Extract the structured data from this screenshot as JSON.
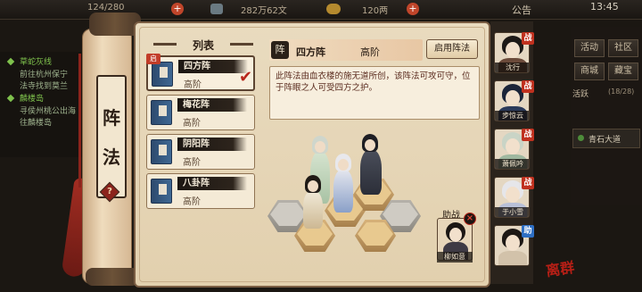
{
  "topbar": {
    "stamina": "124/280",
    "silver": "282万62文",
    "gold": "120两",
    "announce": "公告",
    "time": "13:45"
  },
  "quest": {
    "items": [
      {
        "title": "草蛇灰线",
        "lines": [
          "前往杭州保宁",
          "法寺找到莫兰"
        ]
      },
      {
        "title": "麟楼岛",
        "lines": [
          "寻侯州桃公出海",
          "往麟楼岛"
        ]
      }
    ]
  },
  "sidebar_title": {
    "char1": "阵",
    "char2": "法",
    "help": "?"
  },
  "list": {
    "title": "列表",
    "enabled_tag": "启",
    "formations": [
      {
        "name": "四方阵",
        "level": "高阶"
      },
      {
        "name": "梅花阵",
        "level": "高阶"
      },
      {
        "name": "阴阳阵",
        "level": "高阶"
      },
      {
        "name": "八卦阵",
        "level": "高阶"
      }
    ]
  },
  "detail": {
    "icon": "阵",
    "name": "四方阵",
    "level": "高阶",
    "enable_button": "启用阵法",
    "description": "此阵法由血衣楼的施无道所创，该阵法可攻可守，位于阵眼之人可受四方之护。"
  },
  "helper": {
    "label": "助战",
    "name": "柳如意",
    "remove": "×"
  },
  "party": [
    {
      "name": "沈行",
      "tag": "战"
    },
    {
      "name": "步惊云",
      "tag": "战"
    },
    {
      "name": "萧佩吟",
      "tag": "战"
    },
    {
      "name": "于小雪",
      "tag": "战"
    },
    {
      "name": "",
      "tag": "助"
    }
  ],
  "menu": {
    "row1": [
      "活动",
      "社区"
    ],
    "row2": [
      "商城",
      "藏宝"
    ],
    "activity": "活跃",
    "activity_count": "(18/28)",
    "road": "青石大道"
  },
  "logo": "离群"
}
